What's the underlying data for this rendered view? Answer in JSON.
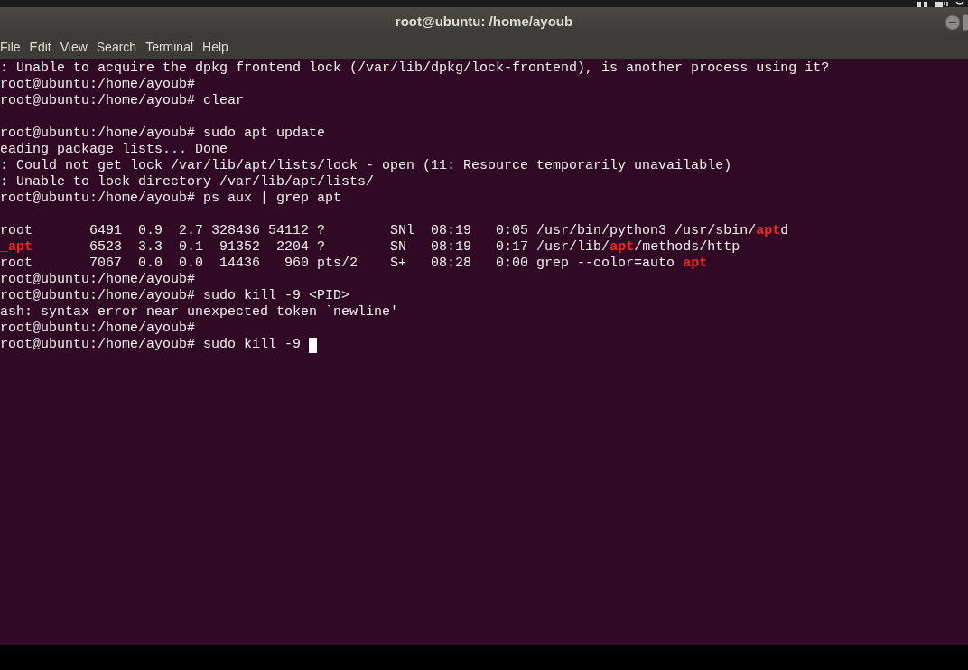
{
  "window": {
    "title": "root@ubuntu: /home/ayoub"
  },
  "menu": [
    "File",
    "Edit",
    "View",
    "Search",
    "Terminal",
    "Help"
  ],
  "terminal": {
    "cursor": true,
    "lines": [
      {
        "kind": "text",
        "segments": [
          {
            "text": ": Unable to acquire the dpkg frontend lock (/var/lib/dpkg/lock-frontend), is another process using it?",
            "highlight": false
          }
        ]
      },
      {
        "kind": "text",
        "segments": [
          {
            "text": "root@ubuntu:/home/ayoub#",
            "highlight": false
          }
        ]
      },
      {
        "kind": "text",
        "segments": [
          {
            "text": "root@ubuntu:/home/ayoub# clear",
            "highlight": false
          }
        ]
      },
      {
        "kind": "blank"
      },
      {
        "kind": "text",
        "segments": [
          {
            "text": "root@ubuntu:/home/ayoub# sudo apt update",
            "highlight": false
          }
        ]
      },
      {
        "kind": "text",
        "segments": [
          {
            "text": "eading package lists... Done",
            "highlight": false
          }
        ]
      },
      {
        "kind": "text",
        "segments": [
          {
            "text": ": Could not get lock /var/lib/apt/lists/lock - open (11: Resource temporarily unavailable)",
            "highlight": false
          }
        ]
      },
      {
        "kind": "text",
        "segments": [
          {
            "text": ": Unable to lock directory /var/lib/apt/lists/",
            "highlight": false
          }
        ]
      },
      {
        "kind": "text",
        "segments": [
          {
            "text": "root@ubuntu:/home/ayoub# ps aux | grep apt",
            "highlight": false
          }
        ]
      },
      {
        "kind": "blank"
      },
      {
        "kind": "text",
        "segments": [
          {
            "text": "root       6491  0.9  2.7 328436 54112 ?        SNl  08:19   0:05 /usr/bin/python3 /usr/sbin/",
            "highlight": false
          },
          {
            "text": "apt",
            "highlight": true
          },
          {
            "text": "d",
            "highlight": false
          }
        ]
      },
      {
        "kind": "text",
        "segments": [
          {
            "text": "_apt",
            "highlight": true
          },
          {
            "text": "       6523  3.3  0.1  91352  2204 ?        SN   08:19   0:17 /usr/lib/",
            "highlight": false
          },
          {
            "text": "apt",
            "highlight": true
          },
          {
            "text": "/methods/http",
            "highlight": false
          }
        ]
      },
      {
        "kind": "text",
        "segments": [
          {
            "text": "root       7067  0.0  0.0  14436   960 pts/2    S+   08:28   0:00 grep --color=auto ",
            "highlight": false
          },
          {
            "text": "apt",
            "highlight": true
          }
        ]
      },
      {
        "kind": "text",
        "segments": [
          {
            "text": "root@ubuntu:/home/ayoub#",
            "highlight": false
          }
        ]
      },
      {
        "kind": "text",
        "segments": [
          {
            "text": "root@ubuntu:/home/ayoub# sudo kill -9 <PID>",
            "highlight": false
          }
        ]
      },
      {
        "kind": "text",
        "segments": [
          {
            "text": "ash: syntax error near unexpected token `newline'",
            "highlight": false
          }
        ]
      },
      {
        "kind": "text",
        "segments": [
          {
            "text": "root@ubuntu:/home/ayoub#",
            "highlight": false
          }
        ]
      },
      {
        "kind": "text",
        "segments": [
          {
            "text": "root@ubuntu:/home/ayoub# sudo kill -9 ",
            "highlight": false
          }
        ]
      }
    ]
  }
}
